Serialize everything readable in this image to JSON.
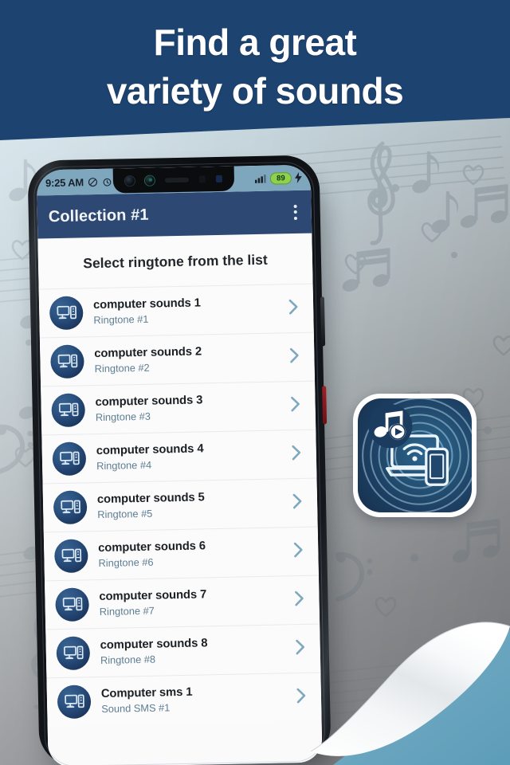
{
  "banner": {
    "line1": "Find a great",
    "line2": "variety of sounds",
    "bg_color": "#1d4370",
    "text_color": "#ffffff"
  },
  "phone": {
    "status_bar": {
      "time": "9:25 AM",
      "battery_level": "89",
      "battery_color": "#8fd14f",
      "bg_color": "#7ea6bd",
      "icons": [
        "dnd-icon",
        "alarm-icon",
        "signal-bars-icon",
        "battery-icon",
        "charging-bolt-icon"
      ]
    },
    "app_bar": {
      "title": "Collection #1",
      "bg_color": "#2c4873",
      "overflow_menu": "more-options-icon"
    },
    "list_header": "Select ringtone from the list",
    "items": [
      {
        "title": "computer sounds 1",
        "subtitle": "Ringtone #1"
      },
      {
        "title": "computer sounds 2",
        "subtitle": "Ringtone #2"
      },
      {
        "title": "computer sounds 3",
        "subtitle": "Ringtone #3"
      },
      {
        "title": "computer sounds 4",
        "subtitle": "Ringtone #4"
      },
      {
        "title": "computer sounds 5",
        "subtitle": "Ringtone #5"
      },
      {
        "title": "computer sounds 6",
        "subtitle": "Ringtone #6"
      },
      {
        "title": "computer sounds 7",
        "subtitle": "Ringtone #7"
      },
      {
        "title": "computer sounds 8",
        "subtitle": "Ringtone #8"
      },
      {
        "title": "Computer sms 1",
        "subtitle": "Sound SMS #1"
      }
    ],
    "item_icon": "desktop-computer-icon",
    "item_chevron": "chevron-right-icon",
    "subtitle_color": "#5d7e93"
  },
  "app_icon": {
    "name": "app-icon-laptop-phone-wifi",
    "badge": "music-note-play-badge",
    "bg_color": "#255579"
  },
  "background": {
    "motifs": [
      "treble-clef",
      "bass-clef",
      "eighth-note",
      "beamed-notes",
      "heart",
      "staff-lines"
    ],
    "gradient_from": "#d3e7f0",
    "gradient_to": "#7e7f81"
  },
  "page_curl": {
    "name": "page-curl-corner",
    "under_color": "#6aa7c0"
  }
}
